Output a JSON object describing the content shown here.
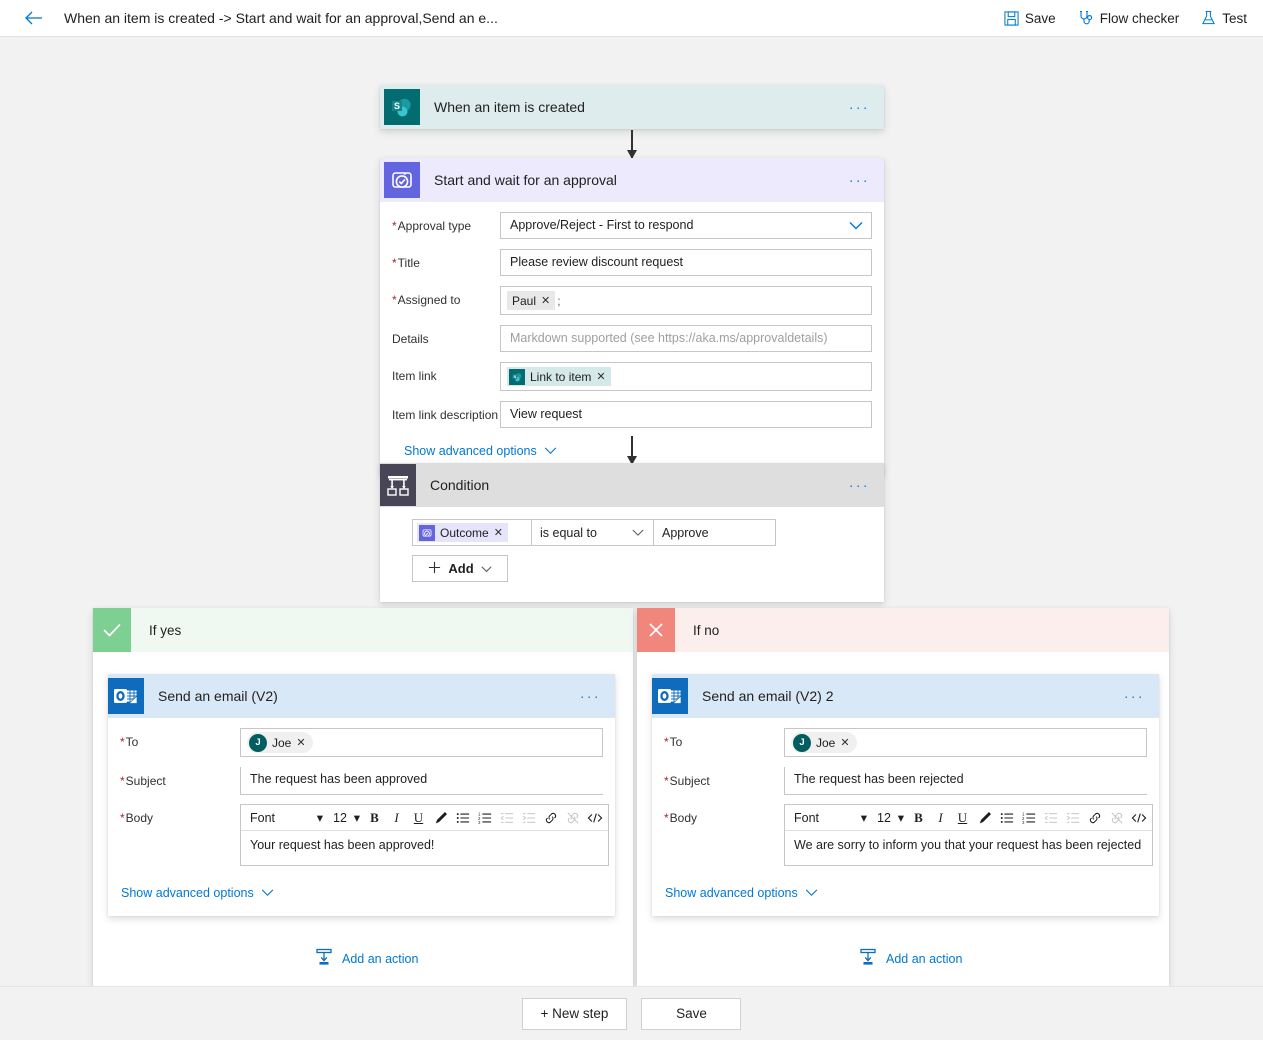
{
  "topbar": {
    "back_icon": "back-arrow-icon",
    "title": "When an item is created -> Start and wait for an approval,Send an e...",
    "save_label": "Save",
    "save_icon": "save-floppy-icon",
    "flow_checker_label": "Flow checker",
    "flow_checker_icon": "stethoscope-icon",
    "test_label": "Test",
    "test_icon": "flask-icon",
    "ellipsis": "···"
  },
  "trigger": {
    "title": "When an item is created",
    "icon": "sharepoint-icon",
    "header_color": "#deeced"
  },
  "approval": {
    "title": "Start and wait for an approval",
    "icon": "approvals-icon",
    "header_color": "#eceafc",
    "fields": {
      "approval_type": {
        "label": "Approval type",
        "required": true,
        "value": "Approve/Reject - First to respond"
      },
      "title": {
        "label": "Title",
        "required": true,
        "value": "Please review discount request"
      },
      "assigned_to": {
        "label": "Assigned to",
        "required": true,
        "token": "Paul",
        "separator": ";"
      },
      "details": {
        "label": "Details",
        "required": false,
        "placeholder": "Markdown supported (see https://aka.ms/approvaldetails)"
      },
      "item_link": {
        "label": "Item link",
        "required": false,
        "token": "Link to item"
      },
      "item_link_description": {
        "label": "Item link description",
        "required": false,
        "value": "View request"
      }
    },
    "advanced_label": "Show advanced options"
  },
  "condition": {
    "title": "Condition",
    "icon": "condition-branch-icon",
    "header_color": "#dededf",
    "left_token": "Outcome",
    "operator": "is equal to",
    "right_value": "Approve",
    "add_label": "Add"
  },
  "branch_yes": {
    "label": "If yes",
    "badge_icon": "checkmark-icon",
    "badge_color": "#7ed092",
    "header_color": "#eff8f1",
    "email": {
      "title": "Send an email (V2)",
      "icon": "outlook-icon",
      "header_color": "#d9e8f7",
      "to_label": "To",
      "to_token": "Joe",
      "to_avatar_initial": "J",
      "subject_label": "Subject",
      "subject_value": "The request has been approved",
      "body_label": "Body",
      "body_value": "Your request has been approved!",
      "advanced_label": "Show advanced options"
    },
    "add_action_label": "Add an action"
  },
  "branch_no": {
    "label": "If no",
    "badge_icon": "close-x-icon",
    "badge_color": "#f1867d",
    "header_color": "#fdeeee",
    "email": {
      "title": "Send an email (V2) 2",
      "icon": "outlook-icon",
      "header_color": "#d9e8f7",
      "to_label": "To",
      "to_token": "Joe",
      "to_avatar_initial": "J",
      "subject_label": "Subject",
      "subject_value": "The request has been rejected",
      "body_label": "Body",
      "body_value": "We are sorry to inform you that your request has been rejected",
      "advanced_label": "Show advanced options"
    },
    "add_action_label": "Add an action"
  },
  "rte_toolbar": {
    "font_label": "Font",
    "size_label": "12",
    "bold": "B",
    "italic": "I",
    "underline": "U",
    "buttons": [
      "font-dropdown",
      "font-size-dropdown",
      "bold-button",
      "italic-button",
      "underline-button",
      "text-highlight-button",
      "bulleted-list-button",
      "numbered-list-button",
      "decrease-indent-button",
      "increase-indent-button",
      "insert-link-button",
      "remove-link-button",
      "code-view-button"
    ]
  },
  "footer": {
    "new_step_label": "+ New step",
    "save_label": "Save"
  }
}
